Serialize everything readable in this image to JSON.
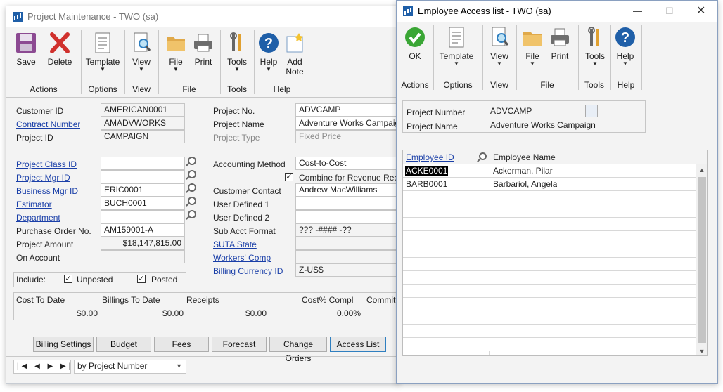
{
  "project_window": {
    "title": "Project Maintenance  -  TWO (sa)",
    "ribbon": {
      "save": "Save",
      "delete": "Delete",
      "template": "Template",
      "view": "View",
      "file": "File",
      "print": "Print",
      "tools": "Tools",
      "help": "Help",
      "add_note": "Add Note",
      "groups": {
        "actions": "Actions",
        "options": "Options",
        "view": "View",
        "file": "File",
        "tools": "Tools",
        "help": "Help"
      }
    },
    "left_fields": {
      "customer_id_label": "Customer ID",
      "customer_id": "AMERICAN0001",
      "contract_number_label": "Contract Number",
      "contract_number": "AMADVWORKS",
      "project_id_label": "Project ID",
      "project_id": "CAMPAIGN",
      "project_class_label": "Project Class ID",
      "project_class": "",
      "project_mgr_label": "Project Mgr ID",
      "project_mgr": "",
      "business_mgr_label": "Business Mgr ID",
      "business_mgr": "ERIC0001",
      "estimator_label": "Estimator",
      "estimator": "BUCH0001",
      "department_label": "Department",
      "department": "",
      "po_label": "Purchase Order No.",
      "po": "AM159001-A",
      "amount_label": "Project Amount",
      "amount": "$18,147,815.00",
      "on_account_label": "On Account",
      "on_account": ""
    },
    "right_fields": {
      "project_no_label": "Project No.",
      "project_no": "ADVCAMP",
      "project_name_label": "Project Name",
      "project_name": "Adventure Works Campaign",
      "project_type_label": "Project Type",
      "project_type": "Fixed Price",
      "accounting_label": "Accounting Method",
      "accounting": "Cost-to-Cost",
      "combine_label": "Combine for Revenue Recognition",
      "contact_label": "Customer Contact",
      "contact": "Andrew MacWilliams",
      "ud1_label": "User Defined 1",
      "ud1": "",
      "ud2_label": "User Defined 2",
      "ud2": "",
      "subacct_label": "Sub Acct Format",
      "subacct": "??? -#### -??",
      "suta_label": "SUTA State",
      "suta": "",
      "workers_label": "Workers' Comp",
      "workers": "",
      "billing_label": "Billing Currency ID",
      "billing": "Z-US$"
    },
    "include": {
      "label": "Include:",
      "unposted": "Unposted",
      "posted": "Posted"
    },
    "totals": {
      "headers": [
        "Cost To Date",
        "Billings To Date",
        "Receipts",
        "Cost% Compl",
        "Committe"
      ],
      "values": [
        "$0.00",
        "$0.00",
        "$0.00",
        "0.00%",
        ""
      ]
    },
    "tabs": [
      "Billing Settings",
      "Budget",
      "Fees",
      "Forecast",
      "Change Orders",
      "Access List"
    ],
    "nav": {
      "sort": "by Project Number"
    }
  },
  "access_window": {
    "title": "Employee Access list  -  TWO (sa)",
    "ribbon": {
      "ok": "OK",
      "template": "Template",
      "view": "View",
      "file": "File",
      "print": "Print",
      "tools": "Tools",
      "help": "Help",
      "groups": {
        "actions": "Actions",
        "options": "Options",
        "view": "View",
        "file": "File",
        "tools": "Tools",
        "help": "Help"
      }
    },
    "project_number_label": "Project Number",
    "project_number": "ADVCAMP",
    "project_name_label": "Project Name",
    "project_name": "Adventure Works Campaign",
    "grid": {
      "col_id": "Employee ID",
      "col_name": "Employee Name",
      "rows": [
        {
          "id": "ACKE0001",
          "name": "Ackerman, Pilar"
        },
        {
          "id": "BARB0001",
          "name": "Barbariol, Angela"
        }
      ]
    }
  },
  "colors": {
    "link": "#1a3fa8",
    "help_blue": "#1f5fa8",
    "ok_green": "#3aa635",
    "delete_red": "#d0312d"
  }
}
